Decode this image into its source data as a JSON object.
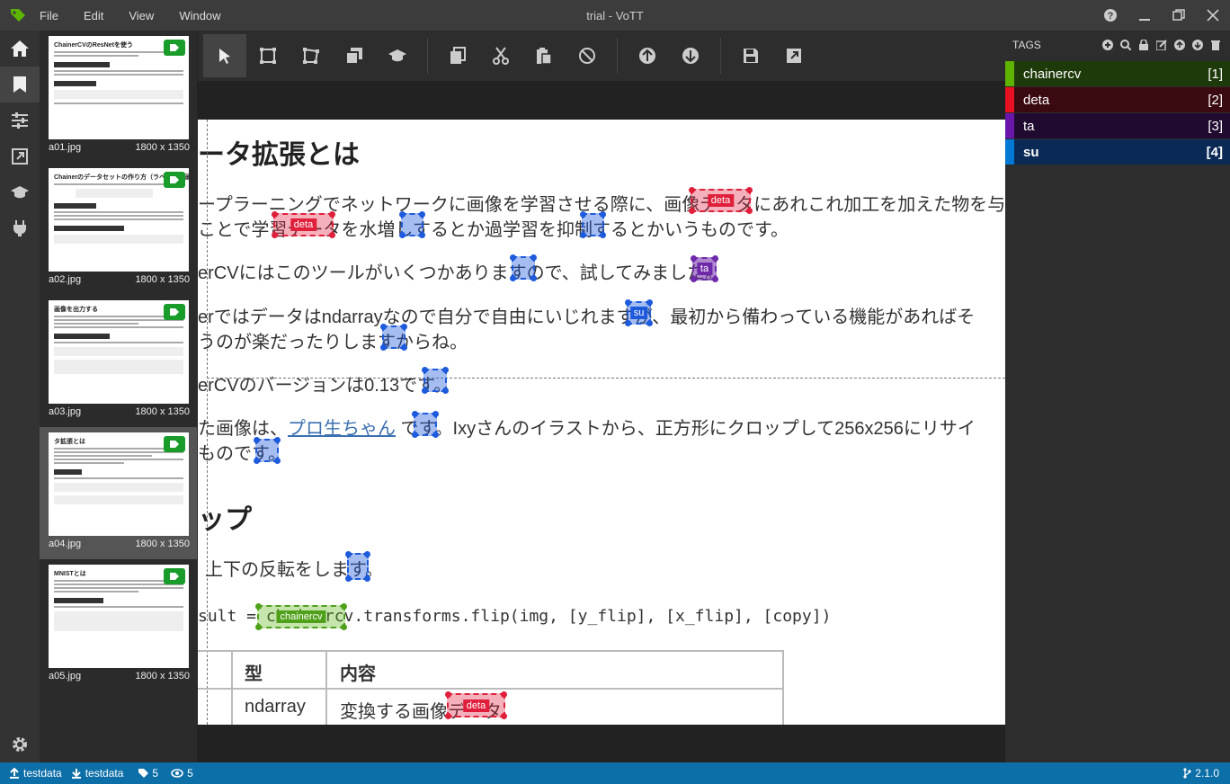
{
  "app": {
    "title": "trial - VoTT",
    "menu": [
      "File",
      "Edit",
      "View",
      "Window"
    ]
  },
  "thumbnails": [
    {
      "name": "a01.jpg",
      "size": "1800 x 1350",
      "heading": "ChainerCVのResNetを使う"
    },
    {
      "name": "a02.jpg",
      "size": "1800 x 1350",
      "heading": "Chainerのデータセットの作り方（ラベル付き画像編）"
    },
    {
      "name": "a03.jpg",
      "size": "1800 x 1350",
      "heading": "画像を出力する"
    },
    {
      "name": "a04.jpg",
      "size": "1800 x 1350",
      "heading": "タ拡張とは"
    },
    {
      "name": "a05.jpg",
      "size": "1800 x 1350",
      "heading": "MNISTとは"
    }
  ],
  "document": {
    "heading": "ータ拡張とは",
    "line1": "ープラーニングでネットワークに画像を学習させる際に、画像データにあれこれ加工を加えた物を与",
    "line2": "ことで学習データを水増しするとか過学習を抑制するとかいうものです。",
    "line3": "erCVにはこのツールがいくつかありますので、試してみました。",
    "line4": "erではデータはndarrayなので自分で自由にいじれますが、最初から備わっている機能があればそ",
    "line5": "うのが楽だったりしますからね。",
    "line6": "erCVのバージョンは0.13です。",
    "line7a": "た画像は、",
    "link": "プロ生ちゃん",
    "line7b": " です。Ixyさんのイラストから、正方形にクロップして256x256にリサイ",
    "line8": "ものです。",
    "heading2": "ップ",
    "line9": "上下の反転をします。",
    "code": "sult = chainercv.transforms.flip(img, [y_flip], [x_flip], [copy])",
    "table": {
      "headers": [
        "型",
        "内容"
      ],
      "row": [
        "ndarray",
        "変換する画像データ"
      ]
    }
  },
  "regions": {
    "deta": "deta",
    "su": "su",
    "ta": "ta",
    "chainercv": "chainercv"
  },
  "tags_panel": {
    "title": "TAGS",
    "tags": [
      {
        "name": "chainercv",
        "hotkey": "[1]",
        "color": "#5db300",
        "bg": "#1f3a0a"
      },
      {
        "name": "deta",
        "hotkey": "[2]",
        "color": "#e81123",
        "bg": "#3a0a10"
      },
      {
        "name": "ta",
        "hotkey": "[3]",
        "color": "#6917aa",
        "bg": "#200a30"
      },
      {
        "name": "su",
        "hotkey": "[4]",
        "color": "#0078d4",
        "bg": "#0a2a55"
      }
    ]
  },
  "statusbar": {
    "source": "testdata",
    "target": "testdata",
    "tag_count": "5",
    "visited_count": "5",
    "version": "2.1.0"
  }
}
